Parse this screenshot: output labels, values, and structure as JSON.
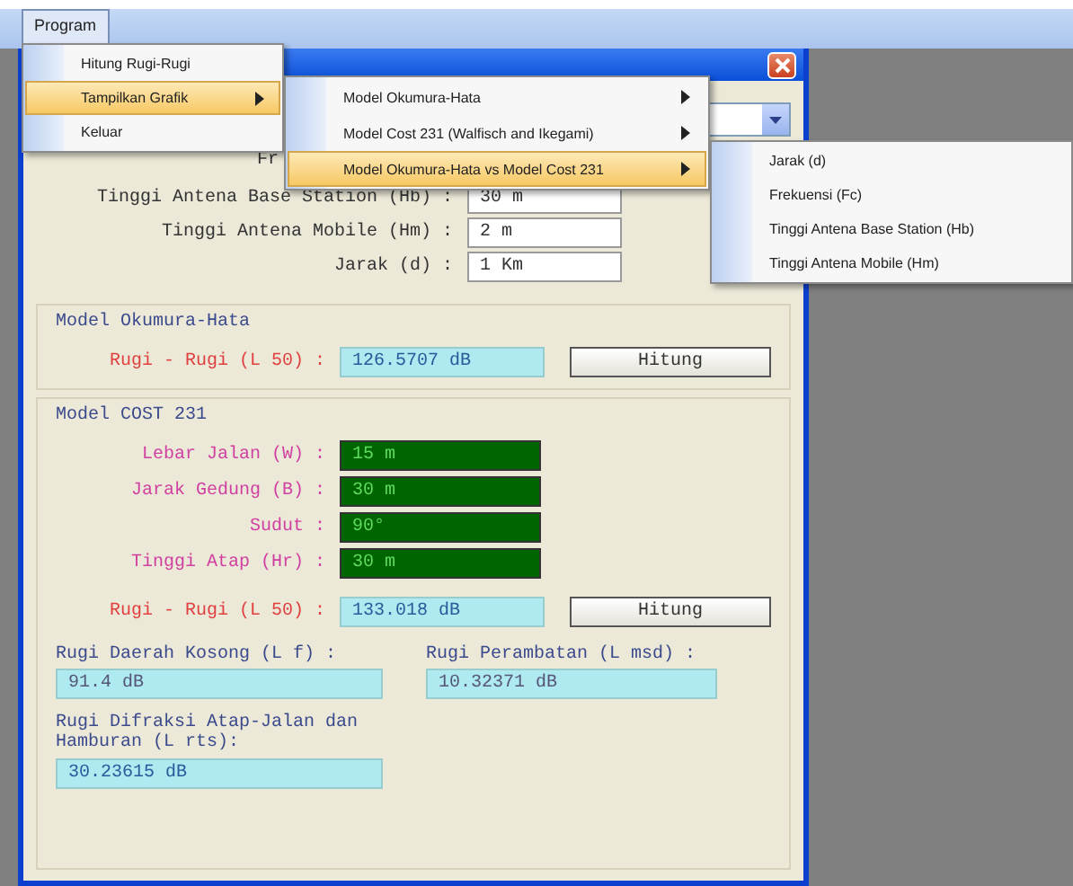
{
  "menubar": {
    "menus": [
      {
        "label": "Program",
        "selected": true
      }
    ]
  },
  "menu": {
    "items": [
      {
        "label": "Hitung Rugi-Rugi",
        "selected": false,
        "has_submenu": false
      },
      {
        "label": "Tampilkan Grafik",
        "selected": true,
        "has_submenu": true
      },
      {
        "label": "Keluar",
        "selected": false,
        "has_submenu": false
      }
    ]
  },
  "submenu": {
    "items": [
      {
        "label": "Model Okumura-Hata",
        "selected": false,
        "has_submenu": true
      },
      {
        "label": "Model Cost 231 (Walfisch and Ikegami)",
        "selected": false,
        "has_submenu": true
      },
      {
        "label": "Model Okumura-Hata vs Model Cost 231",
        "selected": true,
        "has_submenu": true
      }
    ]
  },
  "submenu_2": {
    "items": [
      {
        "label": "Jarak (d)",
        "selected": false,
        "has_submenu": false
      },
      {
        "label": "Frekuensi (Fc)",
        "selected": false,
        "has_submenu": false
      },
      {
        "label": "Tinggi Antena Base Station (Hb)",
        "selected": false,
        "has_submenu": false
      },
      {
        "label": "Tinggi Antena Mobile (Hm)",
        "selected": false,
        "has_submenu": false
      }
    ]
  },
  "window": {
    "partial_label": "Fr",
    "inputs": [
      {
        "label": "Tinggi Antena Base Station (Hb) :",
        "value": "30 m"
      },
      {
        "label": "Tinggi Antena Mobile (Hm) :",
        "value": "2 m"
      },
      {
        "label": "Jarak (d) :",
        "value": "1 Km"
      }
    ],
    "okumura_hata": {
      "title": "Model Okumura-Hata",
      "result_label": "Rugi - Rugi (L 50) :",
      "result": "126.5707 dB",
      "button": "Hitung"
    },
    "cost231": {
      "title": "Model COST 231",
      "params": [
        {
          "label": "Lebar Jalan (W) :",
          "value": "15 m"
        },
        {
          "label": "Jarak Gedung (B) :",
          "value": "30 m"
        },
        {
          "label": "Sudut :",
          "value": "90°"
        },
        {
          "label": "Tinggi Atap (Hr) :",
          "value": "30 m"
        }
      ],
      "result_label": "Rugi - Rugi (L 50) :",
      "result": "133.018 dB",
      "button": "Hitung",
      "details": [
        {
          "label": "Rugi Daerah Kosong (L f) :",
          "value": "91.4 dB"
        },
        {
          "label": "Rugi Perambatan (L msd) :",
          "value": "10.32371 dB"
        },
        {
          "label": "Rugi Difraksi Atap-Jalan dan Hamburan (L rts):",
          "value": "30.23615 dB"
        }
      ]
    }
  }
}
